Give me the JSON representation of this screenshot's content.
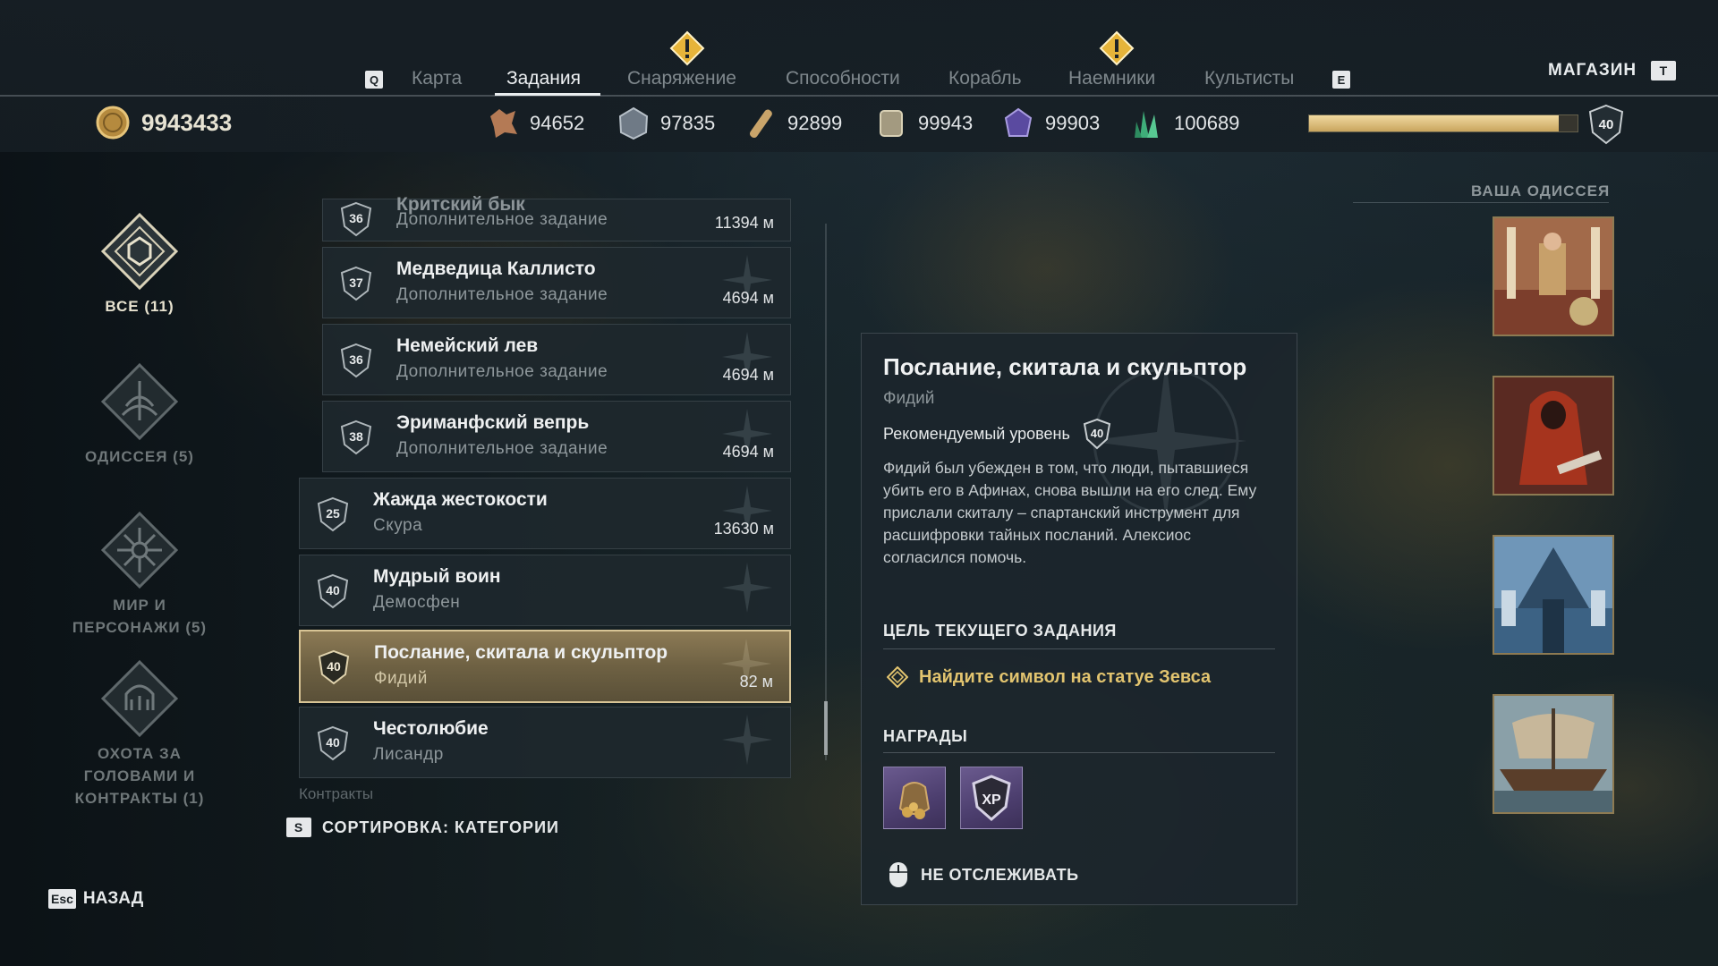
{
  "nav": {
    "key_prev": "Q",
    "key_next": "E",
    "tabs": [
      {
        "label": "Карта",
        "active": false,
        "alert": false
      },
      {
        "label": "Задания",
        "active": true,
        "alert": false
      },
      {
        "label": "Снаряжение",
        "active": false,
        "alert": true
      },
      {
        "label": "Способности",
        "active": false,
        "alert": false
      },
      {
        "label": "Корабль",
        "active": false,
        "alert": false
      },
      {
        "label": "Наемники",
        "active": false,
        "alert": true
      },
      {
        "label": "Культисты",
        "active": false,
        "alert": false
      }
    ],
    "shop_label": "МАГАЗИН",
    "shop_key": "T"
  },
  "resources": {
    "drachmae": "9943433",
    "items": [
      {
        "icon": "leather-icon",
        "value": "94652"
      },
      {
        "icon": "iron-ore-icon",
        "value": "97835"
      },
      {
        "icon": "wood-icon",
        "value": "92899"
      },
      {
        "icon": "bronze-icon",
        "value": "99943"
      },
      {
        "icon": "obsidian-icon",
        "value": "99903"
      },
      {
        "icon": "crystal-icon",
        "value": "100689"
      }
    ],
    "xp_progress": 0.93,
    "player_level": "40"
  },
  "categories": [
    {
      "label": "ВСЕ (11)",
      "active": true,
      "icon": "all-quests-emblem-icon"
    },
    {
      "label": "ОДИССЕЯ (5)",
      "active": false,
      "icon": "odyssey-emblem-icon"
    },
    {
      "label": "МИР И ПЕРСОНАЖИ (5)",
      "active": false,
      "icon": "world-characters-emblem-icon"
    },
    {
      "label": "ОХОТА ЗА ГОЛОВАМИ И КОНТРАКТЫ (1)",
      "active": false,
      "icon": "bounty-contracts-emblem-icon"
    }
  ],
  "quests": [
    {
      "level": "36",
      "name": "Критский бык",
      "sub": "Дополнительное задание",
      "distance": "11394 м",
      "selected": false
    },
    {
      "level": "37",
      "name": "Медведица Каллисто",
      "sub": "Дополнительное задание",
      "distance": "4694 м",
      "selected": false
    },
    {
      "level": "36",
      "name": "Немейский лев",
      "sub": "Дополнительное задание",
      "distance": "4694 м",
      "selected": false
    },
    {
      "level": "38",
      "name": "Эриманфский вепрь",
      "sub": "Дополнительное задание",
      "distance": "4694 м",
      "selected": false
    },
    {
      "level": "25",
      "name": "Жажда жестокости",
      "sub": "Скура",
      "distance": "13630 м",
      "selected": false
    },
    {
      "level": "40",
      "name": "Мудрый воин",
      "sub": "Демосфен",
      "distance": "",
      "selected": false
    },
    {
      "level": "40",
      "name": "Послание, скитала и скульптор",
      "sub": "Фидий",
      "distance": "82 м",
      "selected": true
    },
    {
      "level": "40",
      "name": "Честолюбие",
      "sub": "Лисандр",
      "distance": "",
      "selected": false
    }
  ],
  "list_section_label": "Контракты",
  "sort": {
    "key": "S",
    "label": "СОРТИРОВКА: КАТЕГОРИИ"
  },
  "back": {
    "key": "Esc",
    "label": "НАЗАД"
  },
  "detail": {
    "title": "Послание, скитала и скульптор",
    "giver": "Фидий",
    "recommended_label": "Рекомендуемый уровень",
    "recommended_level": "40",
    "description": "Фидий был убежден в том, что люди, пытавшиеся убить его в Афинах, снова вышли на его след. Ему прислали скиталу – спартанский инструмент для расшифровки тайных посланий. Алексиос согласился помочь.",
    "objective_heading": "ЦЕЛЬ ТЕКУЩЕГО ЗАДАНИЯ",
    "objective": "Найдите символ на статуе Зевса",
    "rewards_heading": "НАГРАДЫ",
    "rewards": [
      {
        "icon": "drachmae-pouch-icon"
      },
      {
        "icon": "xp-icon",
        "label": "XP"
      }
    ],
    "untrack_label": "НЕ ОТСЛЕЖИВАТЬ"
  },
  "odyssey": {
    "label": "ВАША ОДИССЕЯ",
    "chapters": [
      {
        "icon": "odyssey-chapter-palace-icon"
      },
      {
        "icon": "odyssey-chapter-hooded-figure-icon"
      },
      {
        "icon": "odyssey-chapter-atlantis-icon"
      },
      {
        "icon": "odyssey-chapter-ship-icon"
      }
    ]
  },
  "colors": {
    "accent_gold": "#e2c46f",
    "selected_row": "#8c7a55",
    "panel_bg": "#1c262c"
  }
}
